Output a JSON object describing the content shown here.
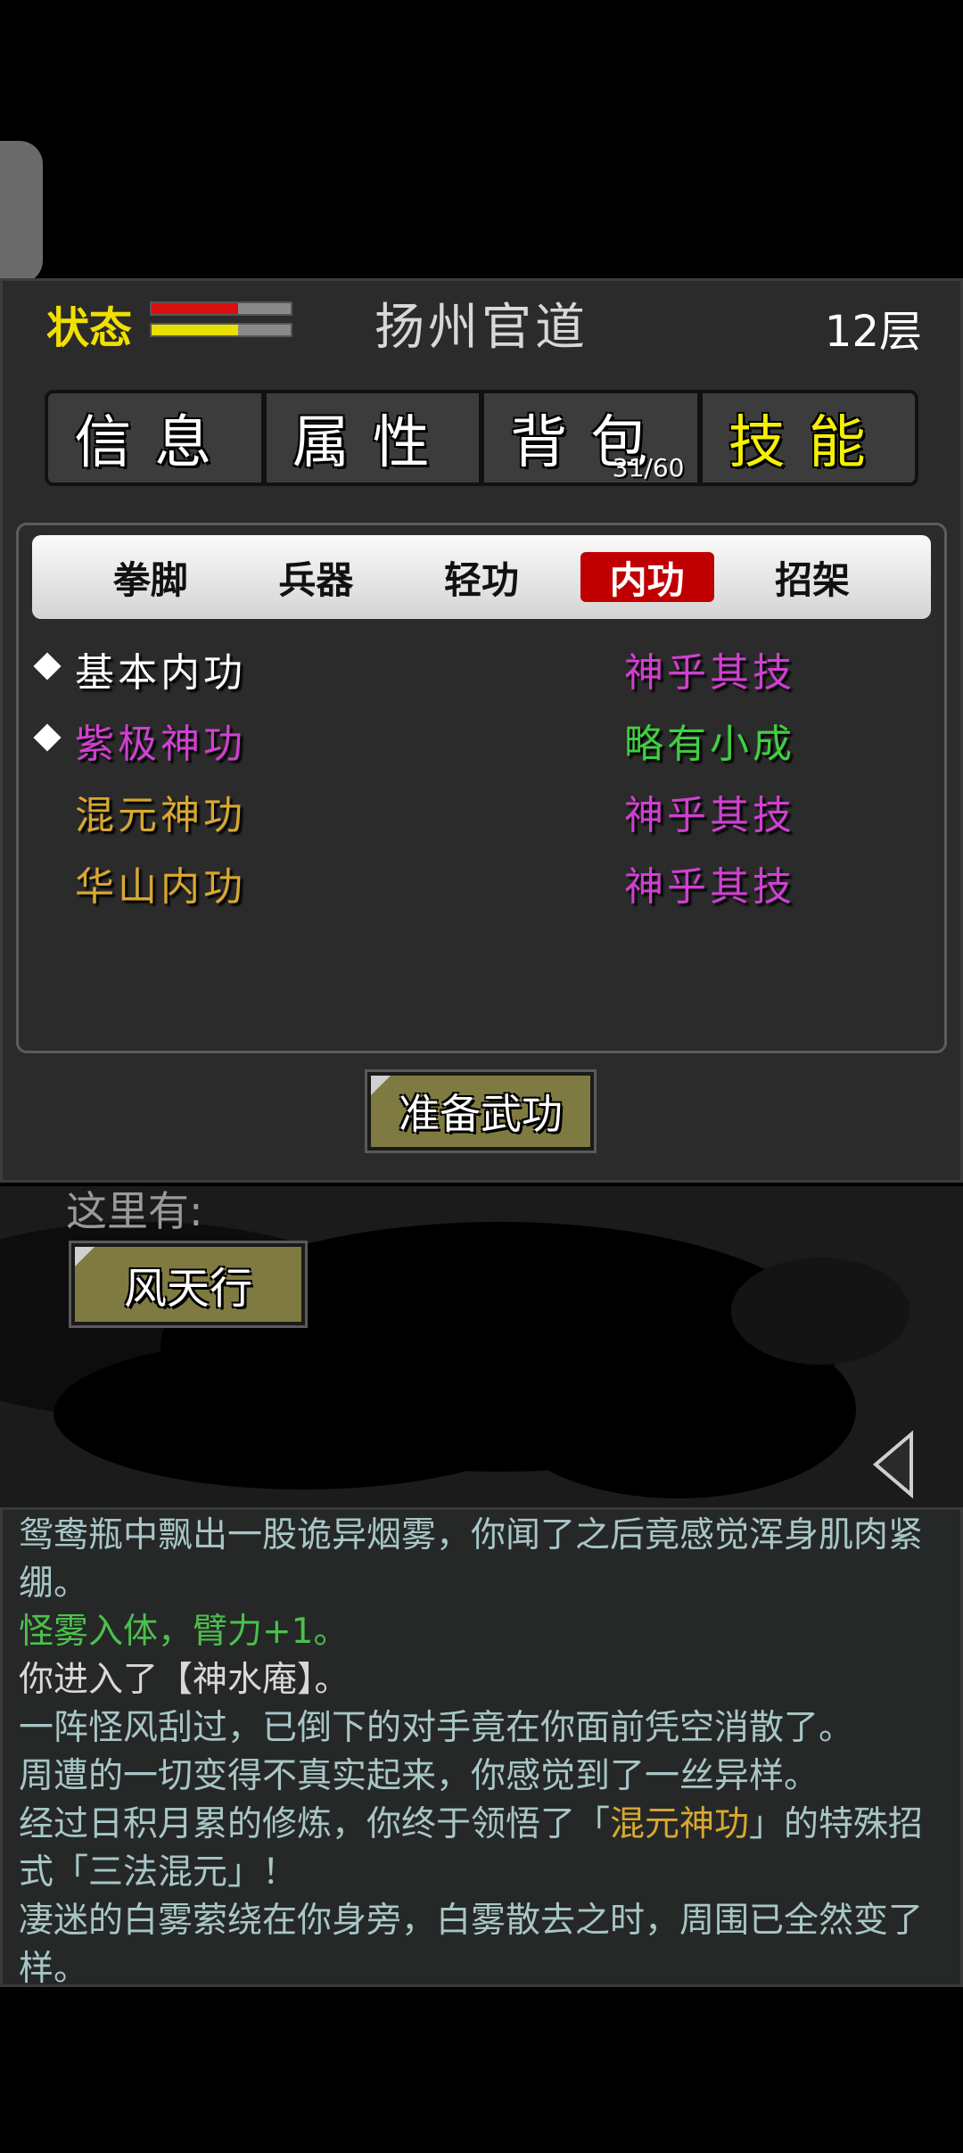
{
  "header": {
    "status_label": "状态",
    "hp_fraction": 0.62,
    "mp_fraction": 0.62,
    "hp_color": "#d81010",
    "mp_color": "#e8e000",
    "location": "扬州官道",
    "floor": "12层"
  },
  "tabs": [
    {
      "label": "信息",
      "active": false
    },
    {
      "label": "属性",
      "active": false
    },
    {
      "label": "背包",
      "active": false,
      "count": "31/60"
    },
    {
      "label": "技能",
      "active": true
    }
  ],
  "subtabs": [
    {
      "label": "拳脚",
      "active": false
    },
    {
      "label": "兵器",
      "active": false
    },
    {
      "label": "轻功",
      "active": false
    },
    {
      "label": "内功",
      "active": true
    },
    {
      "label": "招架",
      "active": false
    }
  ],
  "skills": [
    {
      "name": "基本内功",
      "level": "神乎其技",
      "equipped": true,
      "name_color": "#ffffff",
      "level_color": "#d040d0"
    },
    {
      "name": "紫极神功",
      "level": "略有小成",
      "equipped": true,
      "name_color": "#d040d0",
      "level_color": "#40d040"
    },
    {
      "name": "混元神功",
      "level": "神乎其技",
      "equipped": false,
      "name_color": "#d8a830",
      "level_color": "#d040d0"
    },
    {
      "name": "华山内功",
      "level": "神乎其技",
      "equipped": false,
      "name_color": "#d8a830",
      "level_color": "#d040d0"
    }
  ],
  "prepare_button": "准备武功",
  "scene": {
    "here_label": "这里有:",
    "npc": "风天行"
  },
  "log": [
    {
      "segments": [
        {
          "text": "鸳鸯瓶中飘出一股诡异烟雾，你闻了之后竟感觉浑身肌肉紧绷。",
          "color": "#a8c6c6"
        }
      ]
    },
    {
      "segments": [
        {
          "text": "怪雾入体，臂力+1。",
          "color": "#4cc04c"
        }
      ]
    },
    {
      "segments": [
        {
          "text": "你进入了【神水庵】。",
          "color": "#d8d8d8"
        }
      ]
    },
    {
      "segments": [
        {
          "text": "一阵怪风刮过，已倒下的对手竟在你面前凭空消散了。",
          "color": "#a8c6c6"
        }
      ]
    },
    {
      "segments": [
        {
          "text": "周遭的一切变得不真实起来，你感觉到了一丝异样。",
          "color": "#a8c6c6"
        }
      ]
    },
    {
      "segments": [
        {
          "text": "经过日积月累的修炼，你终于领悟了「",
          "color": "#a8c6c6"
        },
        {
          "text": "混元神功",
          "color": "#d8a830"
        },
        {
          "text": "」的特殊招式「三法混元」！",
          "color": "#a8c6c6"
        }
      ]
    },
    {
      "segments": [
        {
          "text": "凄迷的白雾萦绕在你身旁，白雾散去之时，周围已全然变了样。",
          "color": "#a8c6c6"
        }
      ]
    }
  ]
}
